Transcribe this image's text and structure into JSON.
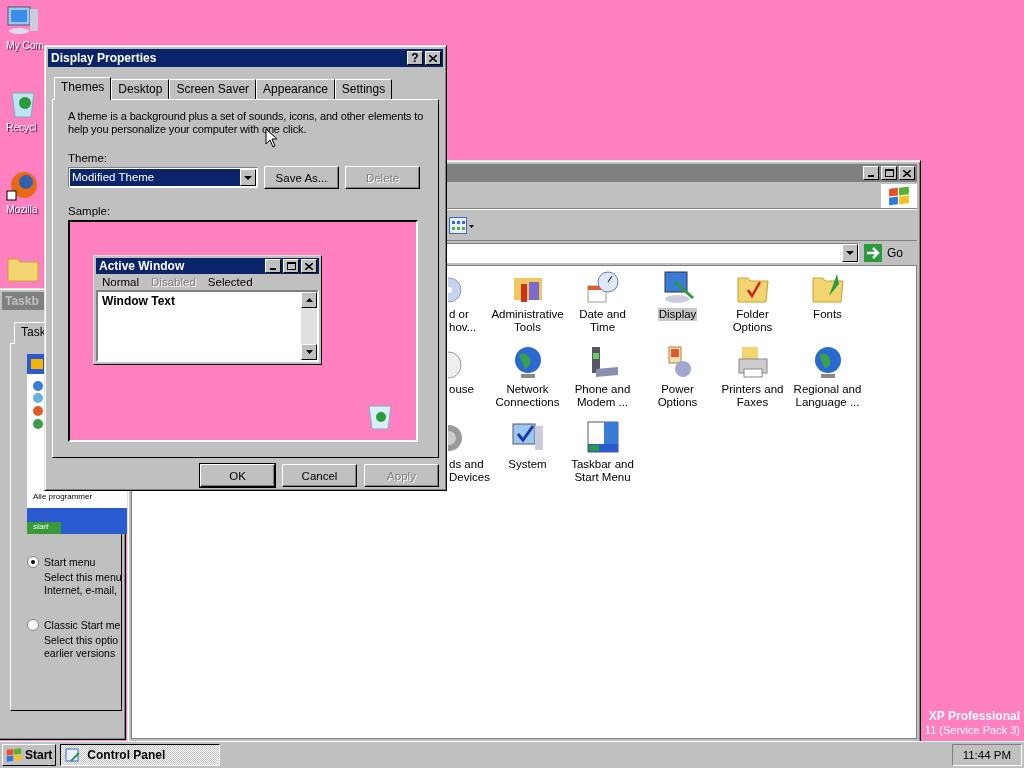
{
  "desktop_icons": [
    {
      "label": "My Com"
    },
    {
      "label": "Recycl"
    },
    {
      "label": "Mozilla"
    }
  ],
  "os_text": [
    "XP Professional",
    "11 (Service Pack 3)"
  ],
  "taskbar_properties_window": {
    "title": "Taskb",
    "tabs": [
      {
        "label": "Task",
        "selected": true
      }
    ],
    "preview": {
      "menu_item": "Alle programmer",
      "start": "start"
    },
    "options": [
      {
        "label": "Start menu",
        "selected": true,
        "description": [
          "Select this menu",
          "Internet, e-mail,"
        ]
      },
      {
        "label": "Classic Start me",
        "selected": false,
        "description": [
          "Select this optio",
          "earlier versions"
        ]
      }
    ]
  },
  "control_panel_window": {
    "address": {
      "go": "Go"
    },
    "items": [
      {
        "label": "d or hov...",
        "selected": false
      },
      {
        "label": "Administrative Tools",
        "selected": false
      },
      {
        "label": "Date and Time",
        "selected": false
      },
      {
        "label": "Display",
        "selected": true
      },
      {
        "label": "Folder Options",
        "selected": false
      },
      {
        "label": "Fonts",
        "selected": false
      },
      {
        "label": "ouse",
        "selected": false
      },
      {
        "label": "Network Connections",
        "selected": false
      },
      {
        "label": "Phone and Modem ...",
        "selected": false
      },
      {
        "label": "Power Options",
        "selected": false
      },
      {
        "label": "Printers and Faxes",
        "selected": false
      },
      {
        "label": "Regional and Language ...",
        "selected": false
      },
      {
        "label": "ds and Devices",
        "selected": false
      },
      {
        "label": "System",
        "selected": false
      },
      {
        "label": "Taskbar and Start Menu",
        "selected": false
      }
    ]
  },
  "display_properties": {
    "title": "Display Properties",
    "help": "?",
    "tabs": [
      {
        "label": "Themes",
        "selected": true
      },
      {
        "label": "Desktop",
        "selected": false
      },
      {
        "label": "Screen Saver",
        "selected": false
      },
      {
        "label": "Appearance",
        "selected": false
      },
      {
        "label": "Settings",
        "selected": false
      }
    ],
    "description": "A theme is a background plus a set of sounds, icons, and other elements to help you personalize your computer with one click.",
    "theme_label": "Theme:",
    "theme_value": "Modified Theme",
    "theme_buttons": [
      {
        "label": "Save As...",
        "disabled": false
      },
      {
        "label": "Delete",
        "disabled": true
      }
    ],
    "sample_label": "Sample:",
    "sample": {
      "window_title": "Active Window",
      "menu": [
        {
          "label": "Normal",
          "kind": "normal"
        },
        {
          "label": "Disabled",
          "kind": "disabled"
        },
        {
          "label": "Selected",
          "kind": "selected"
        }
      ],
      "window_text": "Window Text"
    },
    "buttons": [
      {
        "label": "OK",
        "disabled": false
      },
      {
        "label": "Cancel",
        "disabled": false
      },
      {
        "label": "Apply",
        "disabled": true
      }
    ]
  },
  "taskbar": {
    "start": "Start",
    "tasks": [
      {
        "label": "Control Panel",
        "selected": true
      }
    ],
    "clock": "11:44 PM"
  }
}
